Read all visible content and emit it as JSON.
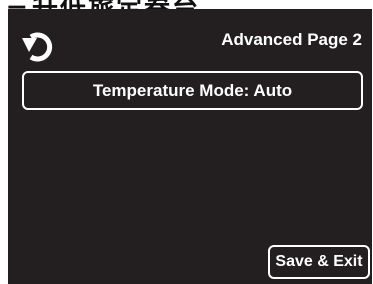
{
  "banner": {
    "text": "三升低旅定叁台"
  },
  "header": {
    "back_icon": "rotate-back-icon",
    "title": "Advanced Page 2"
  },
  "main": {
    "temperature_mode_label": "Temperature Mode: Auto"
  },
  "footer": {
    "save_exit_label": "Save & Exit"
  },
  "colors": {
    "screen_background": "#231f20",
    "foreground": "#ffffff"
  }
}
